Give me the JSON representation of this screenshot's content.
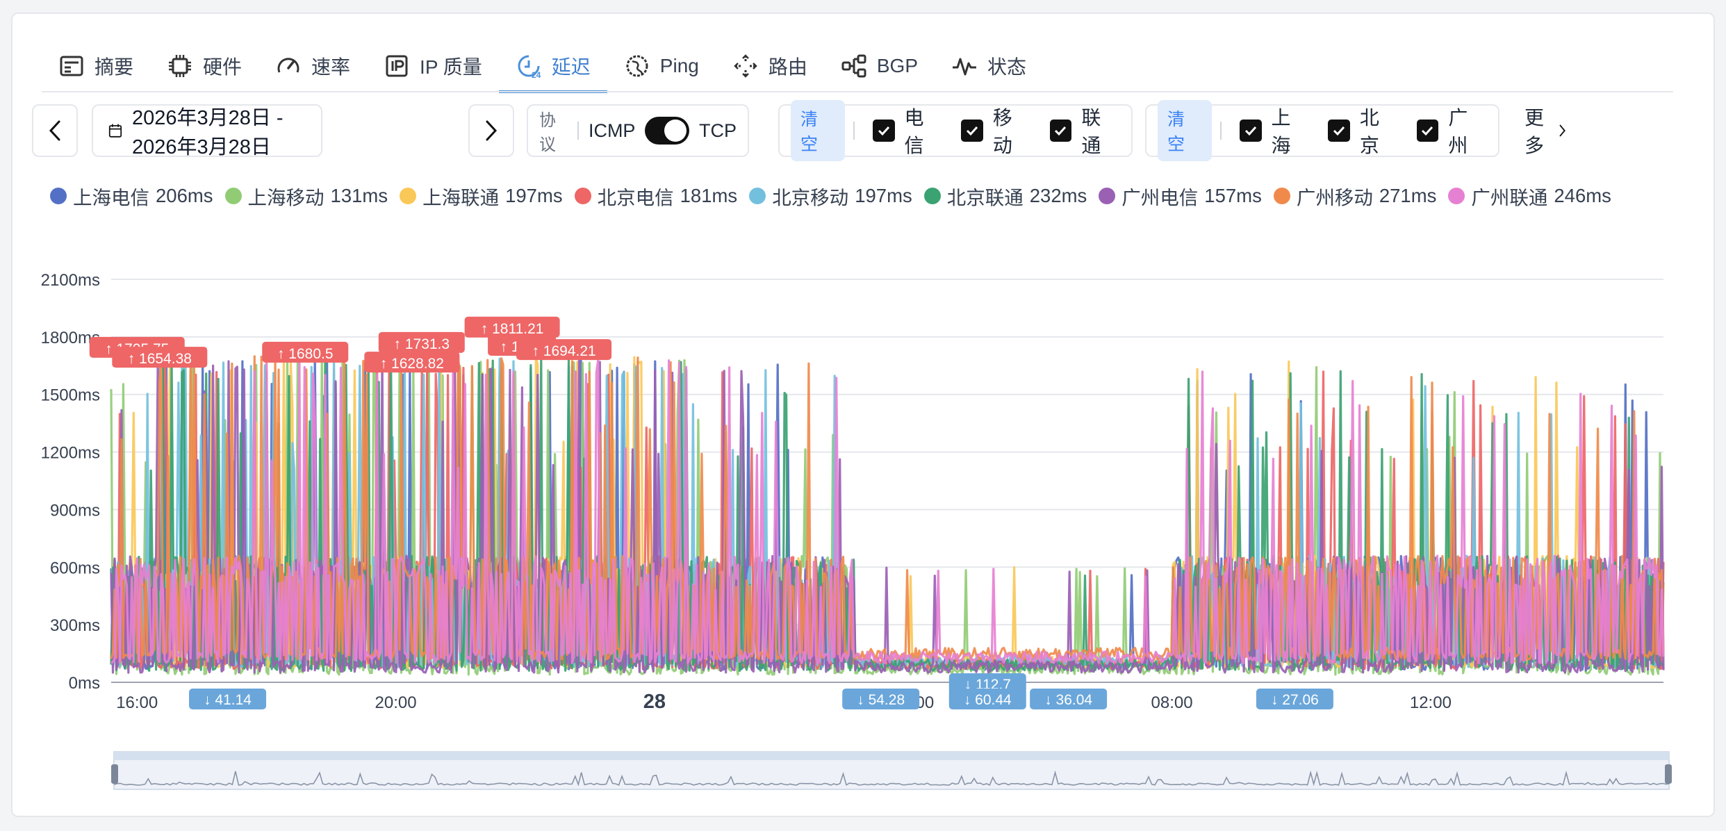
{
  "tabs": [
    {
      "label": "摘要",
      "icon": "summary-icon"
    },
    {
      "label": "硬件",
      "icon": "cpu-icon"
    },
    {
      "label": "速率",
      "icon": "gauge-icon"
    },
    {
      "label": "IP 质量",
      "icon": "ip-icon"
    },
    {
      "label": "延迟",
      "icon": "latency-clock-icon",
      "active": true
    },
    {
      "label": "Ping",
      "icon": "globe-icon"
    },
    {
      "label": "路由",
      "icon": "route-icon"
    },
    {
      "label": "BGP",
      "icon": "network-icon"
    },
    {
      "label": "状态",
      "icon": "pulse-icon"
    }
  ],
  "filters": {
    "date_range": "2026年3月28日 - 2026年3月28日",
    "protocol_label": "协议",
    "protocol_left": "ICMP",
    "protocol_right": "TCP",
    "clear_label": "清空",
    "isp_options": [
      "电信",
      "移动",
      "联通"
    ],
    "city_options": [
      "上海",
      "北京",
      "广州"
    ],
    "more_label": "更多"
  },
  "legend": [
    {
      "name": "上海电信",
      "value": "206ms",
      "color": "#5470c6"
    },
    {
      "name": "上海移动",
      "value": "131ms",
      "color": "#91cc75"
    },
    {
      "name": "上海联通",
      "value": "197ms",
      "color": "#fac858"
    },
    {
      "name": "北京电信",
      "value": "181ms",
      "color": "#ee6666"
    },
    {
      "name": "北京移动",
      "value": "197ms",
      "color": "#73c0de"
    },
    {
      "name": "北京联通",
      "value": "232ms",
      "color": "#3ba272"
    },
    {
      "name": "广州电信",
      "value": "157ms",
      "color": "#9a60b4"
    },
    {
      "name": "广州移动",
      "value": "271ms",
      "color": "#f08a4b"
    },
    {
      "name": "广州联通",
      "value": "246ms",
      "color": "#e680d2"
    }
  ],
  "chart_data": {
    "type": "line",
    "y_labels": [
      "0ms",
      "300ms",
      "600ms",
      "900ms",
      "1200ms",
      "1500ms",
      "1800ms",
      "2100ms"
    ],
    "ylim": [
      0,
      2100
    ],
    "x_labels": [
      {
        "label": "16:00",
        "hour": 16
      },
      {
        "label": "20:00",
        "hour": 20
      },
      {
        "label": "28",
        "hour": 24,
        "bold": true
      },
      {
        "label": "04:00",
        "hour": 28
      },
      {
        "label": "08:00",
        "hour": 32
      },
      {
        "label": "12:00",
        "hour": 36
      }
    ],
    "x_range_hours": [
      15.6,
      39.6
    ],
    "max_markers": [
      {
        "text": "↑ 1705.75",
        "hour": 16.0,
        "value": 1705.75
      },
      {
        "text": "↑ 1654.38",
        "hour": 16.35,
        "value": 1654.38
      },
      {
        "text": "↑ 1680.5",
        "hour": 18.6,
        "value": 1680.5
      },
      {
        "text": "↑ 1731.3",
        "hour": 20.4,
        "value": 1731.3
      },
      {
        "text": "↑ 1628.82",
        "hour": 20.25,
        "value": 1628.82
      },
      {
        "text": "↑ 1811.21",
        "hour": 21.8,
        "value": 1811.21
      },
      {
        "text": "↑ 1716",
        "hour": 21.95,
        "value": 1716
      },
      {
        "text": "↑ 1694.21",
        "hour": 22.6,
        "value": 1694.21
      }
    ],
    "min_markers": [
      {
        "text": "↓ 41.14",
        "hour": 17.4,
        "value": 41.14
      },
      {
        "text": "↓ 54.28",
        "hour": 27.5,
        "value": 54.28
      },
      {
        "text": "↓ 112.7",
        "hour": 29.15,
        "value": 112.7
      },
      {
        "text": "↓ 60.44",
        "hour": 29.15,
        "value": 60.44
      },
      {
        "text": "↓ 36.04",
        "hour": 30.4,
        "value": 36.04
      },
      {
        "text": "↓ 27.06",
        "hour": 33.9,
        "value": 27.06
      }
    ],
    "series": [
      {
        "name": "上海电信",
        "color": "#5470c6",
        "base": 95
      },
      {
        "name": "上海移动",
        "color": "#91cc75",
        "base": 70
      },
      {
        "name": "上海联通",
        "color": "#fac858",
        "base": 105
      },
      {
        "name": "北京电信",
        "color": "#ee6666",
        "base": 100
      },
      {
        "name": "北京移动",
        "color": "#73c0de",
        "base": 110
      },
      {
        "name": "北京联通",
        "color": "#3ba272",
        "base": 90
      },
      {
        "name": "广州电信",
        "color": "#9a60b4",
        "base": 80
      },
      {
        "name": "广州移动",
        "color": "#f08a4b",
        "base": 150
      },
      {
        "name": "广州联通",
        "color": "#e680d2",
        "base": 130
      }
    ],
    "quiet_period_hours": [
      27.1,
      32.0
    ],
    "grid": true
  }
}
